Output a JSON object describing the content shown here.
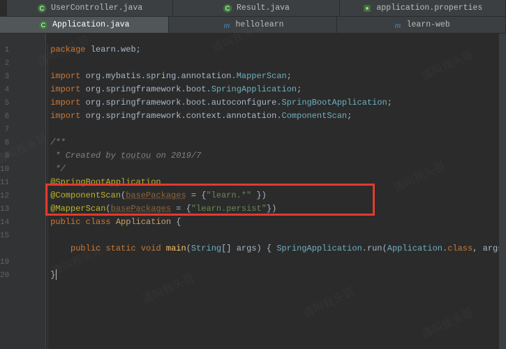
{
  "tabs_top": [
    {
      "label": "UserController.java",
      "icon": "class"
    },
    {
      "label": "Result.java",
      "icon": "class"
    },
    {
      "label": "application.properties",
      "icon": "properties"
    }
  ],
  "tabs_bottom": [
    {
      "label": "Application.java",
      "active": true,
      "icon": "class"
    },
    {
      "label": "hellolearn",
      "icon": "module"
    },
    {
      "label": "learn-web",
      "icon": "module"
    }
  ],
  "code": {
    "l1_kw": "package",
    "l1_p1": "learn",
    "l1_p2": "web",
    "l3_kw": "import",
    "l3_p1": "org",
    "l3_p2": "mybatis",
    "l3_p3": "spring",
    "l3_p4": "annotation",
    "l3_cls": "MapperScan",
    "l4_kw": "import",
    "l4_p1": "org",
    "l4_p2": "springframework",
    "l4_p3": "boot",
    "l4_cls": "SpringApplication",
    "l5_kw": "import",
    "l5_p1": "org",
    "l5_p2": "springframework",
    "l5_p3": "boot",
    "l5_p4": "autoconfigure",
    "l5_cls": "SpringBootApplication",
    "l6_kw": "import",
    "l6_p1": "org",
    "l6_p2": "springframework",
    "l6_p3": "context",
    "l6_p4": "annotation",
    "l6_cls": "ComponentScan",
    "l8_c": "/**",
    "l9_c1": " * Created by ",
    "l9_c2": "toutou",
    "l9_c3": " on 2019/7",
    "l10_c": " */",
    "l11_ann": "@SpringBootApplication",
    "l12_ann": "@ComponentScan",
    "l12_par": "basePackages",
    "l12_str": "\"learn.*\"",
    "l13_ann": "@MapperScan",
    "l13_par": "basePackages",
    "l13_str": "\"learn.persist\"",
    "l14_k1": "public",
    "l14_k2": "class",
    "l14_cls": "Application",
    "l15_k1": "public",
    "l15_k2": "static",
    "l15_k3": "void",
    "l15_m": "main",
    "l15_t": "String",
    "l15_a": "args",
    "l15_c1": "SpringApplication",
    "l15_mm": "run",
    "l15_c2": "Application",
    "l15_k4": "class"
  },
  "line_numbers": [
    "1",
    "2",
    "3",
    "4",
    "5",
    "6",
    "7",
    "8",
    "9",
    "10",
    "11",
    "12",
    "13",
    "14",
    "15",
    "",
    "19",
    "20"
  ]
}
